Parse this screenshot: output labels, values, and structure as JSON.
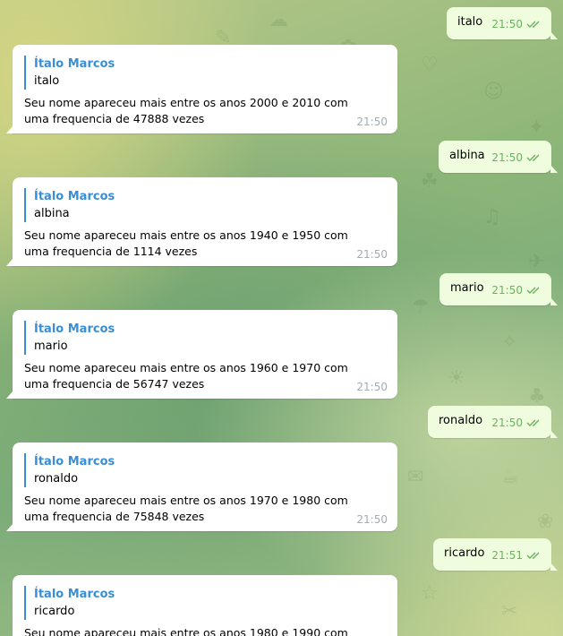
{
  "colors": {
    "incoming_bubble": "#ffffff",
    "outgoing_bubble": "#effdde",
    "reply_accent": "#3a8ed5",
    "outgoing_time": "#6cb261",
    "incoming_time": "#a0acb6"
  },
  "messages": [
    {
      "direction": "out",
      "text": "italo",
      "time": "21:50",
      "status": "read"
    },
    {
      "direction": "in",
      "reply_name": "Ítalo Marcos",
      "reply_text": "italo",
      "text": "Seu nome apareceu mais entre os anos 2000 e 2010 com uma frequencia de 47888 vezes",
      "time": "21:50"
    },
    {
      "direction": "out",
      "text": "albina",
      "time": "21:50",
      "status": "read"
    },
    {
      "direction": "in",
      "reply_name": "Ítalo Marcos",
      "reply_text": "albina",
      "text": "Seu nome apareceu mais entre os anos 1940 e 1950 com uma frequencia de 1114 vezes",
      "time": "21:50"
    },
    {
      "direction": "out",
      "text": "mario",
      "time": "21:50",
      "status": "read"
    },
    {
      "direction": "in",
      "reply_name": "Ítalo Marcos",
      "reply_text": "mario",
      "text": "Seu nome apareceu mais entre os anos 1960 e 1970 com uma frequencia de 56747 vezes",
      "time": "21:50"
    },
    {
      "direction": "out",
      "text": "ronaldo",
      "time": "21:50",
      "status": "read"
    },
    {
      "direction": "in",
      "reply_name": "Ítalo Marcos",
      "reply_text": "ronaldo",
      "text": "Seu nome apareceu mais entre os anos 1970 e 1980 com uma frequencia de 75848 vezes",
      "time": "21:50"
    },
    {
      "direction": "out",
      "text": "ricardo",
      "time": "21:51",
      "status": "read"
    },
    {
      "direction": "in",
      "reply_name": "Ítalo Marcos",
      "reply_text": "ricardo",
      "text": "Seu nome apareceu mais entre os anos 1980 e 1990 com uma",
      "time": ""
    }
  ]
}
